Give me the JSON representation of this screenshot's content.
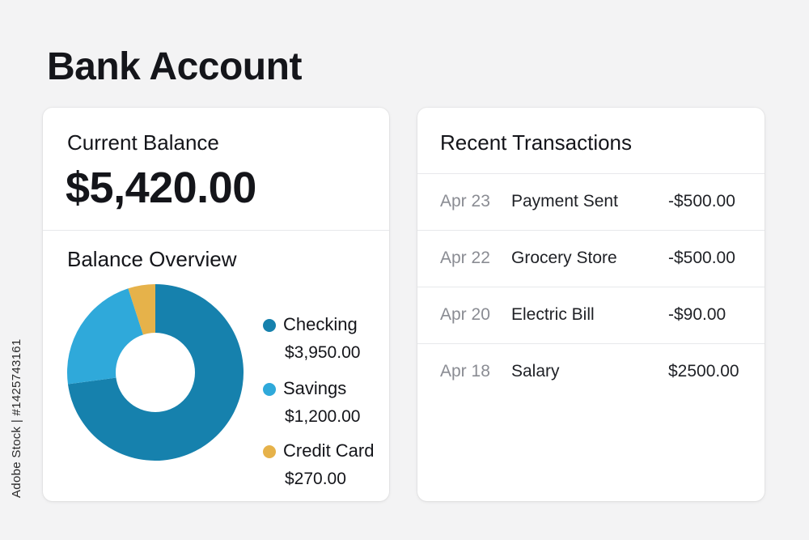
{
  "page": {
    "title": "Bank Account"
  },
  "balance": {
    "label": "Current Balance",
    "amount": "$5,420.00"
  },
  "overview": {
    "title": "Balance Overview",
    "items": [
      {
        "name": "Checking",
        "value": "$3,950.00",
        "amount": 3950,
        "color": "#1681ad"
      },
      {
        "name": "Savings",
        "value": "$1,200.00",
        "amount": 1200,
        "color": "#2fa9da"
      },
      {
        "name": "Credit Card",
        "value": "$270.00",
        "amount": 270,
        "color": "#e6b24a"
      }
    ]
  },
  "transactions": {
    "title": "Recent Transactions",
    "rows": [
      {
        "date": "Apr 23",
        "description": "Payment Sent",
        "amount": "-$500.00"
      },
      {
        "date": "Apr 22",
        "description": "Grocery Store",
        "amount": "-$500.00"
      },
      {
        "date": "Apr 20",
        "description": "Electric Bill",
        "amount": "-$90.00"
      },
      {
        "date": "Apr 18",
        "description": "Salary",
        "amount": "$2500.00"
      }
    ]
  },
  "watermark": {
    "side_text": "Adobe Stock | #1425743161"
  }
}
